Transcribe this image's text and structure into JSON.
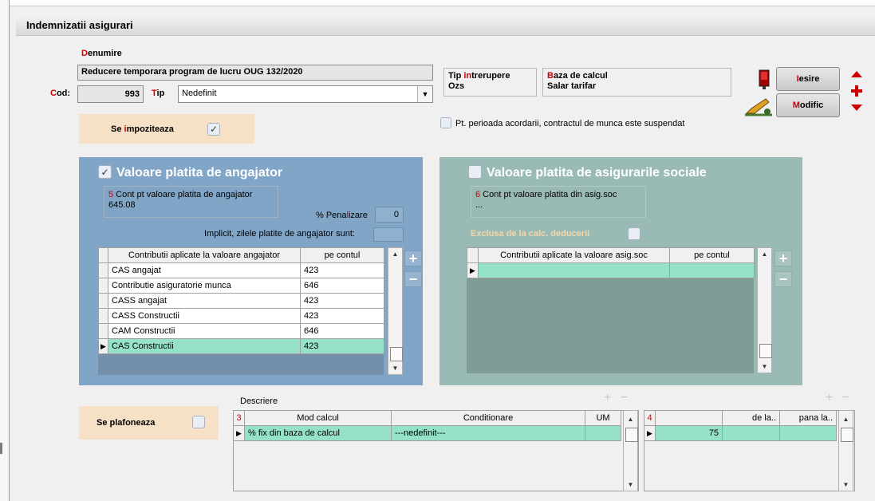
{
  "window": {
    "title": "Indemnizatii asigurari"
  },
  "header": {
    "denumire_label": "Denumire",
    "denumire_first": "D",
    "denumire_rest": "enumire",
    "denumire_value": "Reducere temporara program de lucru OUG 132/2020",
    "cod_label_first": "C",
    "cod_label_rest": "od:",
    "cod_value": "993",
    "tip_label_first": "T",
    "tip_label_rest": "ip",
    "tip_value": "Nedefinit",
    "tip_intrerupere_pre": "Tip ",
    "tip_intrerupere_red": "in",
    "tip_intrerupere_post": "trerupere",
    "tip_intrerupere_value": "Ozs",
    "baza_first": "B",
    "baza_rest": "aza de calcul",
    "baza_value": "Salar tarifar",
    "se_impoziteaza_pre": "Se ",
    "se_impoziteaza_red": "i",
    "se_impoziteaza_post": "mpoziteaza",
    "suspendat_label": "Pt. perioada acordarii, contractul de munca este suspendat"
  },
  "buttons": {
    "iesire_first": "I",
    "iesire_rest": "esire",
    "modific_first": "M",
    "modific_rest": "odific"
  },
  "angajator": {
    "title": "Valoare platita de angajator",
    "checked": "✓",
    "cont_num": "5",
    "cont_label": " Cont pt valoare platita de angajator",
    "cont_value": "645.08",
    "penalizare_pre": "% Pena",
    "penalizare_red": "l",
    "penalizare_post": "izare",
    "penalizare_value": "0",
    "implicit_label": "Implicit, zilele platite de angajator sunt:",
    "col1": "Contributii aplicate la valoare angajator",
    "col2": "pe contul",
    "rows": [
      {
        "name": "CAS angajat",
        "cont": "423"
      },
      {
        "name": "Contributie asiguratorie munca",
        "cont": "646"
      },
      {
        "name": "CASS angajat",
        "cont": "423"
      },
      {
        "name": "CASS Constructii",
        "cont": "423"
      },
      {
        "name": "CAM Constructii",
        "cont": "646"
      },
      {
        "name": "CAS Constructii",
        "cont": "423"
      }
    ]
  },
  "asig_soc": {
    "title": "Valoare platita de asigurarile sociale",
    "cont_num": "6",
    "cont_label": " Cont pt valoare platita din asig.soc",
    "cont_value": "...",
    "exclusa_label": "Exclusa de la calc. deducerii",
    "col1": "Contributii aplicate la valoare asig.soc",
    "col2": "pe contul"
  },
  "plafon": {
    "label": "Se plafoneaza",
    "descriere": "Descriere",
    "grid3_num": "3",
    "col_mod": "Mod calcul",
    "col_cond": "Conditionare",
    "col_um": "UM",
    "row_mod": "% fix din baza de calcul",
    "row_cond": "---nedefinit---",
    "row_um": "",
    "grid4_num": "4",
    "col_dela": "de la..",
    "col_panala": "pana la..",
    "row_value": "75"
  },
  "colors": {
    "accent_red": "#d00000",
    "panel_blue": "#81a5c7",
    "panel_teal": "#9abbb5",
    "selected_row": "#96e2c9",
    "peach": "#f7e1c6"
  }
}
